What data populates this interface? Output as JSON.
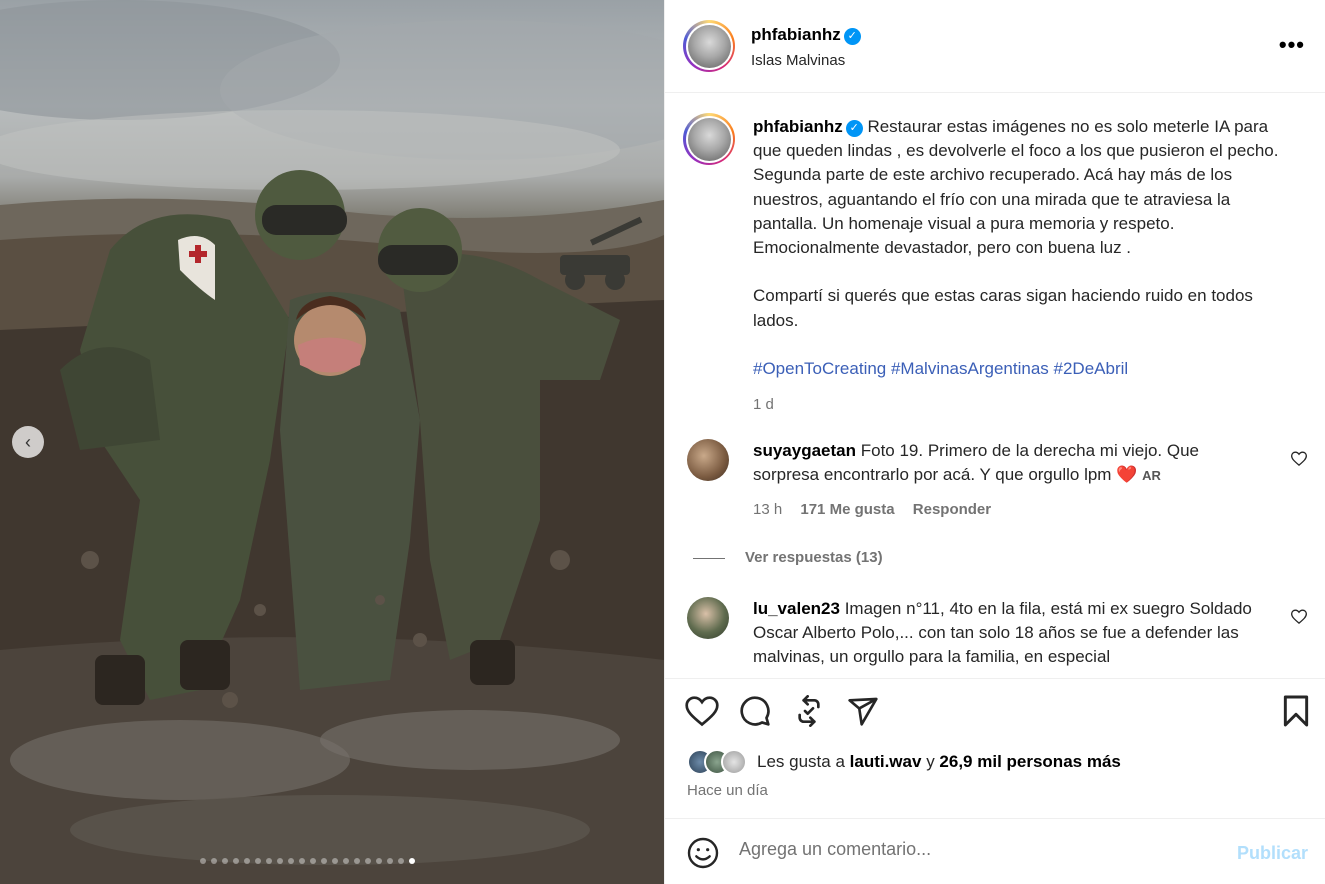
{
  "post": {
    "image_alt_icon": "photo-soldiers-illustration",
    "carousel_total": 20,
    "carousel_active": 20
  },
  "header": {
    "username": "phfabianhz",
    "location": "Islas Malvinas",
    "verified_icon": "verified-badge-icon",
    "more_icon": "more-options-icon"
  },
  "caption": {
    "username": "phfabianhz",
    "text_p1": "Restaurar estas imágenes no es solo meterle IA para que queden lindas , es devolverle el foco a los que pusieron el pecho. Segunda parte de este archivo recuperado. Acá hay más de los nuestros, aguantando el frío con una mirada que te atraviesa la pantalla. Un homenaje visual a pura memoria y respeto. Emocionalmente devastador, pero con buena luz .",
    "text_p2": "Compartí si querés que estas caras sigan haciendo ruido en todos lados.",
    "hashtags": "#OpenToCreating #MalvinasArgentinas #2DeAbril",
    "time": "1 d"
  },
  "comments": [
    {
      "username": "suyaygaetan",
      "text": "Foto 19. Primero de la derecha mi viejo. Que sorpresa encontrarlo por acá. Y que orgullo lpm",
      "emoji": "❤️",
      "flag": "AR",
      "time": "13 h",
      "likes": "171 Me gusta",
      "reply": "Responder",
      "view_replies": "Ver respuestas (13)"
    },
    {
      "username": "lu_valen23",
      "text": "Imagen n°11, 4to en la fila, está mi ex suegro Soldado Oscar Alberto Polo,... con tan solo 18 años se fue a defender las malvinas, un orgullo para la familia, en especial"
    }
  ],
  "actions": {
    "likes_prefix": "Les gusta a",
    "likes_user": "lauti.wav",
    "likes_join": "y",
    "likes_rest": "26,9 mil personas más",
    "time_ago": "Hace un día"
  },
  "add_comment": {
    "placeholder": "Agrega un comentario...",
    "publish": "Publicar"
  },
  "colors": {
    "link": "#3b5fb7",
    "verified": "#0095f6",
    "publish_disabled": "#b2dffc",
    "heart_emoji": "#e0245e"
  }
}
